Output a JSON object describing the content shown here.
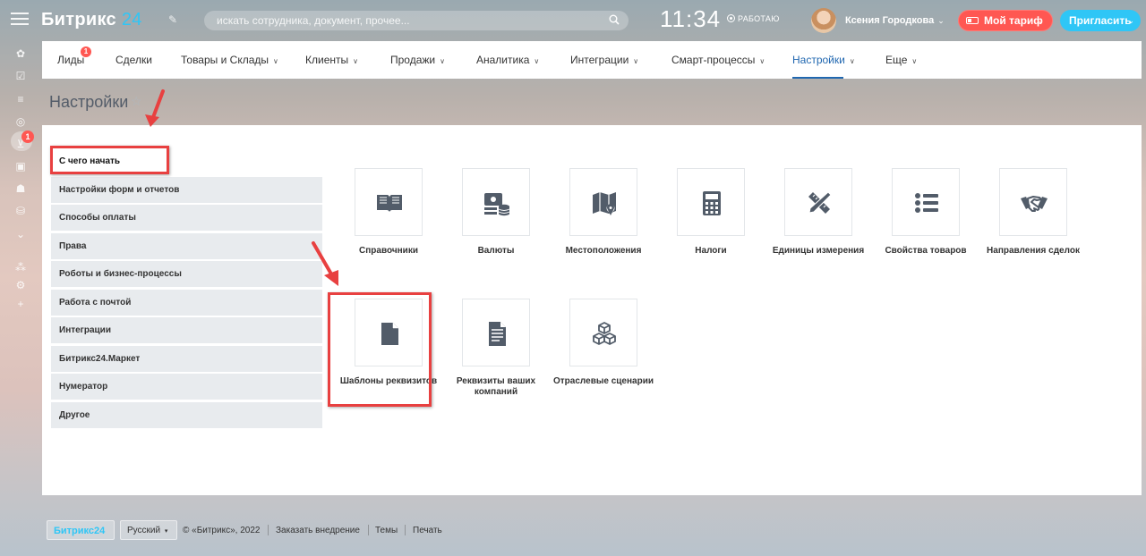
{
  "header": {
    "logo_text": "Битрикс",
    "logo_number": "24",
    "search_placeholder": "искать сотрудника, документ, прочее...",
    "time": "11:34",
    "work_status": "РАБОТАЮ",
    "user_name": "Ксения Городкова",
    "tariff_label": "Мой тариф",
    "invite_label": "Пригласить"
  },
  "rail": {
    "badge_count": "1"
  },
  "menu": {
    "items": [
      {
        "label": "Лиды",
        "badge": "1"
      },
      {
        "label": "Сделки"
      },
      {
        "label": "Товары и Склады"
      },
      {
        "label": "Клиенты"
      },
      {
        "label": "Продажи"
      },
      {
        "label": "Аналитика"
      },
      {
        "label": "Интеграции"
      },
      {
        "label": "Смарт-процессы"
      },
      {
        "label": "Настройки"
      },
      {
        "label": "Еще"
      }
    ]
  },
  "page": {
    "title": "Настройки"
  },
  "sidebar": {
    "items": [
      {
        "label": "С чего начать"
      },
      {
        "label": "Настройки форм и отчетов"
      },
      {
        "label": "Способы оплаты"
      },
      {
        "label": "Права"
      },
      {
        "label": "Роботы и бизнес-процессы"
      },
      {
        "label": "Работа с почтой"
      },
      {
        "label": "Интеграции"
      },
      {
        "label": "Битрикс24.Маркет"
      },
      {
        "label": "Нумератор"
      },
      {
        "label": "Другое"
      }
    ]
  },
  "tiles": [
    {
      "label": "Справочники",
      "icon": "book-icon"
    },
    {
      "label": "Валюты",
      "icon": "currency-icon"
    },
    {
      "label": "Местоположения",
      "icon": "map-icon"
    },
    {
      "label": "Налоги",
      "icon": "calculator-icon"
    },
    {
      "label": "Единицы измерения",
      "icon": "ruler-pencil-icon"
    },
    {
      "label": "Свойства товаров",
      "icon": "list-icon"
    },
    {
      "label": "Направления сделок",
      "icon": "handshake-icon"
    },
    {
      "label": "Шаблоны реквизитов",
      "icon": "document-icon"
    },
    {
      "label": "Реквизиты ваших компаний",
      "icon": "text-document-icon"
    },
    {
      "label": "Отраслевые сценарии",
      "icon": "cubes-icon"
    }
  ],
  "footer": {
    "logo": "Битрикс24",
    "language": "Русский",
    "copyright": "© «Битрикс», 2022",
    "order_link": "Заказать внедрение",
    "themes_link": "Темы",
    "print_link": "Печать"
  },
  "colors": {
    "accent": "#2fc6f6",
    "tariff": "#ff5752",
    "active_menu": "#2067b0",
    "annotation": "#e84040"
  }
}
